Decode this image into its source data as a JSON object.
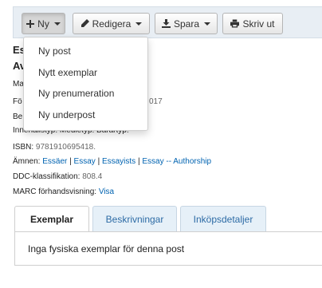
{
  "toolbar": {
    "new_label": "Ny",
    "edit_label": "Redigera",
    "save_label": "Spara",
    "print_label": "Skriv ut"
  },
  "new_menu": {
    "items": [
      {
        "label": "Ny post"
      },
      {
        "label": "Nytt exemplar"
      },
      {
        "label": "Ny prenumeration"
      },
      {
        "label": "Ny underpost"
      }
    ]
  },
  "record": {
    "title_fragment_1": "Es",
    "title_fragment_2": "Av",
    "visible_fragments": {
      "ma": "Ma",
      "fo": "Fö",
      "year": "017",
      "be": "Be",
      "content_type_line": "Innehållstyp: Medietyp: Bärartyp:"
    },
    "isbn_label": "ISBN:",
    "isbn_value": "9781910695418.",
    "subjects_label": "Ämnen:",
    "subjects": [
      "Essäer",
      "Essay",
      "Essayists",
      "Essay -- Authorship"
    ],
    "ddc_label": "DDC-klassifikation:",
    "ddc_value": "808.4",
    "marc_label": "MARC förhandsvisning:",
    "marc_link": "Visa"
  },
  "tabs": [
    {
      "label": "Exemplar",
      "active": true
    },
    {
      "label": "Beskrivningar",
      "active": false
    },
    {
      "label": "Inköpsdetaljer",
      "active": false
    }
  ],
  "panel": {
    "text": "Inga fysiska exemplar för denna post"
  },
  "colors": {
    "link": "#0063b1",
    "tab_inactive_text": "#2d6ba5",
    "toolbar_bg": "#e8eef4"
  }
}
